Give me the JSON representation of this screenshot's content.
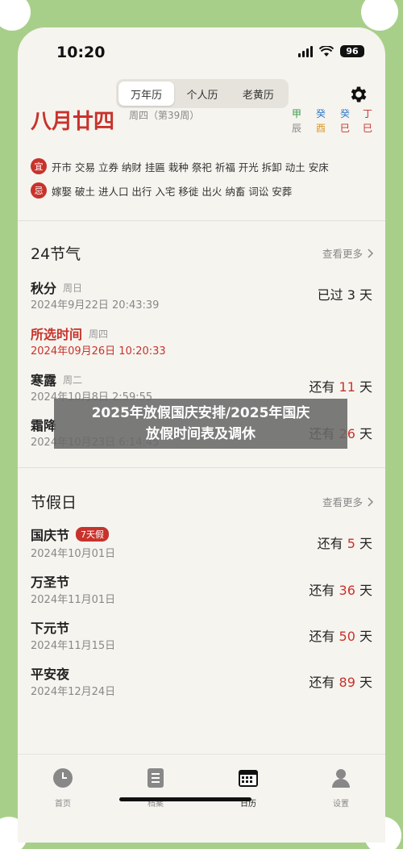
{
  "status_bar": {
    "time": "10:20",
    "battery": "96"
  },
  "segmented": {
    "items": [
      "万年历",
      "个人历",
      "老黄历"
    ],
    "active": 0
  },
  "top_card": {
    "big_date": "八月廿四",
    "week_label": "周四（第39周）",
    "ganzhi_columns": [
      {
        "top": "甲",
        "bottom": "辰",
        "top_color": "#3a9a4a",
        "bottom_color": "#888888"
      },
      {
        "top": "癸",
        "bottom": "酉",
        "top_color": "#3a7fc8",
        "bottom_color": "#d79a2a"
      },
      {
        "top": "癸",
        "bottom": "巳",
        "top_color": "#3a7fc8",
        "bottom_color": "#c7332c"
      },
      {
        "top": "丁",
        "bottom": "巳",
        "top_color": "#c7332c",
        "bottom_color": "#c7332c"
      }
    ],
    "yi": {
      "badge": "宜",
      "text": "开市 交易 立券 纳财 挂匾 栽种 祭祀 祈福 开光 拆卸 动土 安床"
    },
    "ji": {
      "badge": "忌",
      "text": "嫁娶 破土 进人口 出行 入宅 移徙 出火 纳畜 词讼 安葬"
    }
  },
  "solar_terms": {
    "title": "24节气",
    "more": "查看更多",
    "items": [
      {
        "name": "秋分",
        "weekday": "周日",
        "date": "2024年9月22日 20:43:39",
        "prefix": "已过",
        "days": "3",
        "suffix": "天",
        "selected": false,
        "days_red": false
      },
      {
        "name": "所选时间",
        "weekday": "周四",
        "date": "2024年09月26日 10:20:33",
        "prefix": "",
        "days": "",
        "suffix": "",
        "selected": true,
        "days_red": false
      },
      {
        "name": "寒露",
        "weekday": "周二",
        "date": "2024年10月8日 2:59:55",
        "prefix": "还有",
        "days": "11",
        "suffix": "天",
        "selected": false,
        "days_red": true
      },
      {
        "name": "霜降",
        "weekday": "",
        "date": "2024年10月23日 6:14:45",
        "prefix": "还有",
        "days": "26",
        "suffix": "天",
        "selected": false,
        "days_red": true
      }
    ]
  },
  "holidays": {
    "title": "节假日",
    "more": "查看更多",
    "items": [
      {
        "name": "国庆节",
        "tag": "7天假",
        "date": "2024年10月01日",
        "prefix": "还有",
        "days": "5",
        "suffix": "天"
      },
      {
        "name": "万圣节",
        "tag": "",
        "date": "2024年11月01日",
        "prefix": "还有",
        "days": "36",
        "suffix": "天"
      },
      {
        "name": "下元节",
        "tag": "",
        "date": "2024年11月15日",
        "prefix": "还有",
        "days": "50",
        "suffix": "天"
      },
      {
        "name": "平安夜",
        "tag": "",
        "date": "2024年12月24日",
        "prefix": "还有",
        "days": "89",
        "suffix": "天"
      }
    ]
  },
  "banner": {
    "line1": "2025年放假国庆安排/2025年国庆",
    "line2": "放假时间表及调休"
  },
  "tabbar": {
    "items": [
      "首页",
      "档案",
      "日历",
      "设置"
    ],
    "active": 2
  },
  "colors": {
    "accent_red": "#c7332c",
    "background_green": "#a8cf8a",
    "yi_badge": "#c7332c",
    "ji_badge": "#c7332c"
  }
}
